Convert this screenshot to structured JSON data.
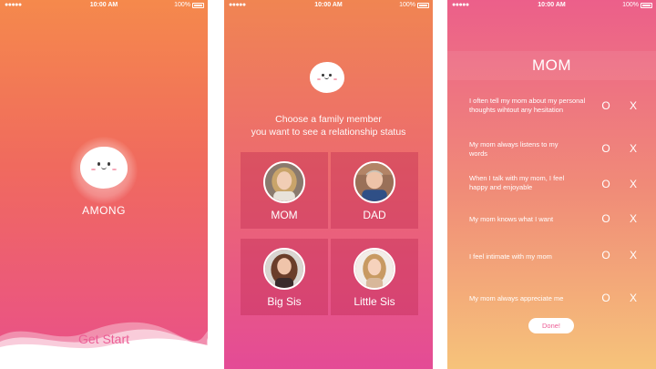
{
  "status": {
    "carrier_dots": "●●●●● ",
    "wifi_icon": "wifi-icon",
    "time": "10:00 AM",
    "battery": "100%"
  },
  "colors": {
    "accent": "#ec5d95",
    "gradient_top": "#f5894c",
    "gradient_bottom": "#e9508a"
  },
  "splash": {
    "app_name": "AMONG",
    "cta": "Get Start"
  },
  "family": {
    "prompt_line1": "Choose a family member",
    "prompt_line2": "you want to see a relationship status",
    "members": [
      {
        "label": "MOM"
      },
      {
        "label": "DAD"
      },
      {
        "label": "Big Sis"
      },
      {
        "label": "Little Sis"
      }
    ]
  },
  "survey": {
    "title": "MOM",
    "option_yes": "O",
    "option_no": "X",
    "questions": [
      "I often tell my mom about my personal thoughts wihtout any hesitation",
      "My mom always listens to my words",
      "When I talk with my mom, I feel happy and enjoyable",
      "My mom knows what I want",
      "I feel intimate with my mom",
      "My mom always appreciate me"
    ],
    "done": "Done!"
  }
}
